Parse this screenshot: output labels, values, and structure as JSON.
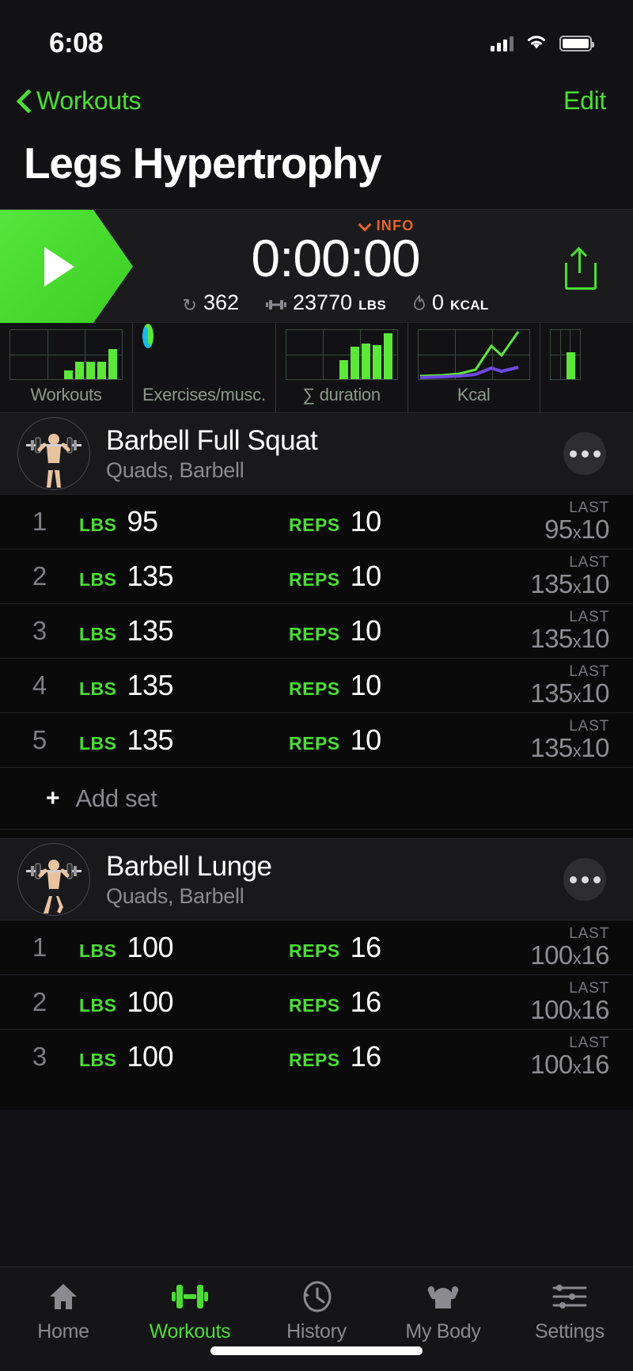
{
  "status_bar": {
    "time": "6:08",
    "cellular_icon": "cellular-signal-icon",
    "wifi_icon": "wifi-icon",
    "battery_icon": "battery-full-icon"
  },
  "navbar": {
    "back_label": "Workouts",
    "back_icon": "chevron-left-icon",
    "edit_label": "Edit"
  },
  "header": {
    "title": "Legs Hypertrophy"
  },
  "timer": {
    "play_icon": "play-triangle-icon",
    "info_label": "INFO",
    "info_icon": "chevron-down-icon",
    "value": "0:00:00",
    "share_icon": "share-upload-icon",
    "stats": [
      {
        "icon": "repetitions-icon",
        "value": "362",
        "unit": ""
      },
      {
        "icon": "dumbbell-icon",
        "value": "23770",
        "unit": "LBS"
      },
      {
        "icon": "flame-icon",
        "value": "0",
        "unit": "KCAL"
      }
    ]
  },
  "chart_data": [
    {
      "type": "bar",
      "title": "Workouts",
      "categories": [
        "1",
        "2",
        "3",
        "4",
        "5",
        "6",
        "7"
      ],
      "values": [
        0,
        0,
        0,
        22,
        45,
        45,
        45,
        75
      ],
      "ylim": [
        0,
        100
      ],
      "grid": true,
      "color": "#5ce839"
    },
    {
      "type": "pie",
      "title": "Exercises/musc.",
      "labels": [
        "green",
        "cyan"
      ],
      "values": [
        72,
        28
      ],
      "colors": [
        "#5ce839",
        "#16bde8"
      ],
      "style": "donut"
    },
    {
      "type": "bar",
      "title": "∑ duration",
      "categories": [
        "1",
        "2",
        "3",
        "4",
        "5",
        "6"
      ],
      "values": [
        0,
        0,
        0,
        42,
        72,
        80,
        78,
        100
      ],
      "ylim": [
        0,
        100
      ],
      "grid": true,
      "color": "#5ce839"
    },
    {
      "type": "line",
      "title": "Kcal",
      "series": [
        {
          "name": "kcal",
          "values": [
            6,
            6,
            7,
            8,
            55,
            40,
            95
          ],
          "color": "#5ce839"
        },
        {
          "name": "secondary",
          "values": [
            4,
            4,
            5,
            6,
            14,
            10,
            16
          ],
          "color": "#6d49e0"
        }
      ],
      "ylim": [
        0,
        100
      ],
      "grid": true
    }
  ],
  "charts_labels": [
    "Workouts",
    "Exercises/musc.",
    "∑ duration",
    "Kcal"
  ],
  "exercises": [
    {
      "name": "Barbell Full Squat",
      "subtitle": "Quads, Barbell",
      "avatar_icon": "barbell-squat-figure-icon",
      "more_icon": "more-options-icon",
      "weight_label": "LBS",
      "reps_label": "REPS",
      "last_caption": "LAST",
      "add_set_label": "Add set",
      "sets": [
        {
          "num": "1",
          "weight": "95",
          "reps": "10",
          "last_weight": "95",
          "last_reps": "10"
        },
        {
          "num": "2",
          "weight": "135",
          "reps": "10",
          "last_weight": "135",
          "last_reps": "10"
        },
        {
          "num": "3",
          "weight": "135",
          "reps": "10",
          "last_weight": "135",
          "last_reps": "10"
        },
        {
          "num": "4",
          "weight": "135",
          "reps": "10",
          "last_weight": "135",
          "last_reps": "10"
        },
        {
          "num": "5",
          "weight": "135",
          "reps": "10",
          "last_weight": "135",
          "last_reps": "10"
        }
      ]
    },
    {
      "name": "Barbell Lunge",
      "subtitle": "Quads, Barbell",
      "avatar_icon": "barbell-lunge-figure-icon",
      "more_icon": "more-options-icon",
      "weight_label": "LBS",
      "reps_label": "REPS",
      "last_caption": "LAST",
      "sets": [
        {
          "num": "1",
          "weight": "100",
          "reps": "16",
          "last_weight": "100",
          "last_reps": "16"
        },
        {
          "num": "2",
          "weight": "100",
          "reps": "16",
          "last_weight": "100",
          "last_reps": "16"
        },
        {
          "num": "3",
          "weight": "100",
          "reps": "16",
          "last_weight": "100",
          "last_reps": "16"
        }
      ]
    }
  ],
  "tabbar": {
    "items": [
      {
        "label": "Home",
        "icon": "home-icon",
        "active": false
      },
      {
        "label": "Workouts",
        "icon": "dumbbell-icon",
        "active": true
      },
      {
        "label": "History",
        "icon": "clock-back-icon",
        "active": false
      },
      {
        "label": "My Body",
        "icon": "muscle-body-icon",
        "active": false
      },
      {
        "label": "Settings",
        "icon": "sliders-icon",
        "active": false
      }
    ]
  },
  "colors": {
    "accent_green": "#4cdd35",
    "chart_green": "#5ce839",
    "info_orange": "#e8642a",
    "cyan": "#16bde8",
    "purple": "#6d49e0",
    "background": "#0a0a0b"
  }
}
